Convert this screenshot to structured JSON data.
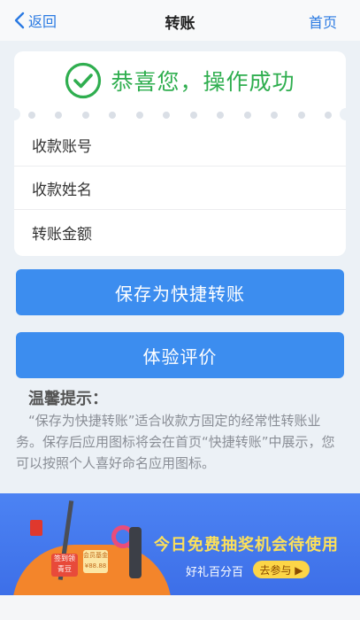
{
  "nav": {
    "back_label": "返回",
    "title": "转账",
    "home_label": "首页"
  },
  "result": {
    "message": "恭喜您，操作成功",
    "icon": "check-circle-icon",
    "color": "#2FAE4F"
  },
  "details": {
    "rows": [
      {
        "label": "收款账号"
      },
      {
        "label": "收款姓名"
      },
      {
        "label": "转账金额"
      }
    ]
  },
  "actions": {
    "save_label": "保存为快捷转账",
    "rate_label": "体验评价",
    "color": "#3C8DEF"
  },
  "tips": {
    "title": "温馨提示：",
    "body": "“保存为快捷转账”适合收款方固定的经常性转账业务。保存后应用图标将会在首页“快捷转账”中展示，您可以按照个人喜好命名应用图标。"
  },
  "banner": {
    "headline": "今日免费抽奖机会待使用",
    "subtitle": "好礼百分百",
    "join_label": "去参与 ▶",
    "sign1_text": "签到领青豆",
    "sign2_text": "会员基金",
    "sign2_amount": "¥88.88"
  }
}
